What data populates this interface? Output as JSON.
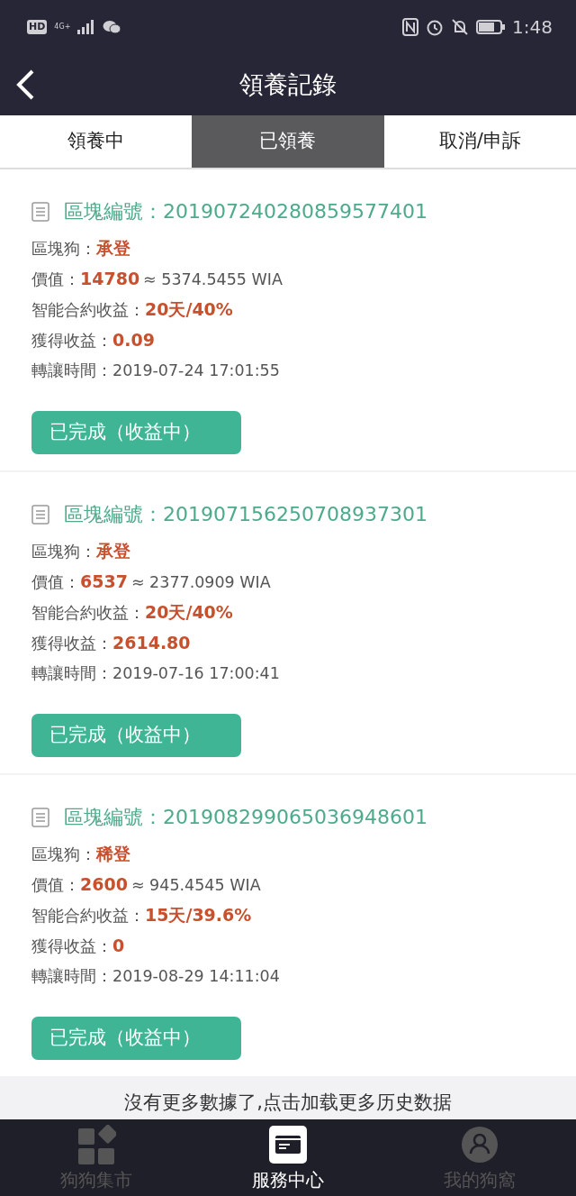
{
  "status_bar": {
    "network_badge": "HD",
    "network_type": "4G+",
    "time": "1:48"
  },
  "header": {
    "title": "領養記錄"
  },
  "tabs": [
    {
      "label": "領養中",
      "selected": false
    },
    {
      "label": "已領養",
      "selected": true
    },
    {
      "label": "取消/申訴",
      "selected": false
    }
  ],
  "records": [
    {
      "block_label": "區塊編號：",
      "block_no": "201907240280859577401",
      "fields": [
        {
          "label": "區塊狗：",
          "value": "承登",
          "kind": "highlight"
        },
        {
          "label": "價值：",
          "value": "14780",
          "note": "≈ 5374.5455 WIA",
          "kind": "highlight"
        },
        {
          "label": "智能合約收益：",
          "value": "20天/40%",
          "kind": "highlight"
        },
        {
          "label": "獲得收益：",
          "value": "0.09",
          "kind": "highlight"
        },
        {
          "label": "轉讓時間：",
          "value": "2019-07-24 17:01:55",
          "kind": "plain"
        }
      ],
      "status_button": "已完成（收益中）"
    },
    {
      "block_label": "區塊編號：",
      "block_no": "201907156250708937301",
      "fields": [
        {
          "label": "區塊狗：",
          "value": "承登",
          "kind": "highlight"
        },
        {
          "label": "價值：",
          "value": "6537",
          "note": "≈ 2377.0909 WIA",
          "kind": "highlight"
        },
        {
          "label": "智能合約收益：",
          "value": "20天/40%",
          "kind": "highlight"
        },
        {
          "label": "獲得收益：",
          "value": "2614.80",
          "kind": "highlight"
        },
        {
          "label": "轉讓時間：",
          "value": "2019-07-16 17:00:41",
          "kind": "plain"
        }
      ],
      "status_button": "已完成（收益中）"
    },
    {
      "block_label": "區塊編號：",
      "block_no": "201908299065036948601",
      "fields": [
        {
          "label": "區塊狗：",
          "value": "稀登",
          "kind": "highlight"
        },
        {
          "label": "價值：",
          "value": "2600",
          "note": "≈ 945.4545 WIA",
          "kind": "highlight"
        },
        {
          "label": "智能合約收益：",
          "value": "15天/39.6%",
          "kind": "highlight"
        },
        {
          "label": "獲得收益：",
          "value": "0",
          "kind": "highlight"
        },
        {
          "label": "轉讓時間：",
          "value": "2019-08-29 14:11:04",
          "kind": "plain"
        }
      ],
      "status_button": "已完成（收益中）"
    }
  ],
  "footer_message": "沒有更多數據了,点击加载更多历史数据",
  "bottom_nav": [
    {
      "label": "狗狗集市",
      "selected": false
    },
    {
      "label": "服務中心",
      "selected": true
    },
    {
      "label": "我的狗窩",
      "selected": false
    }
  ]
}
